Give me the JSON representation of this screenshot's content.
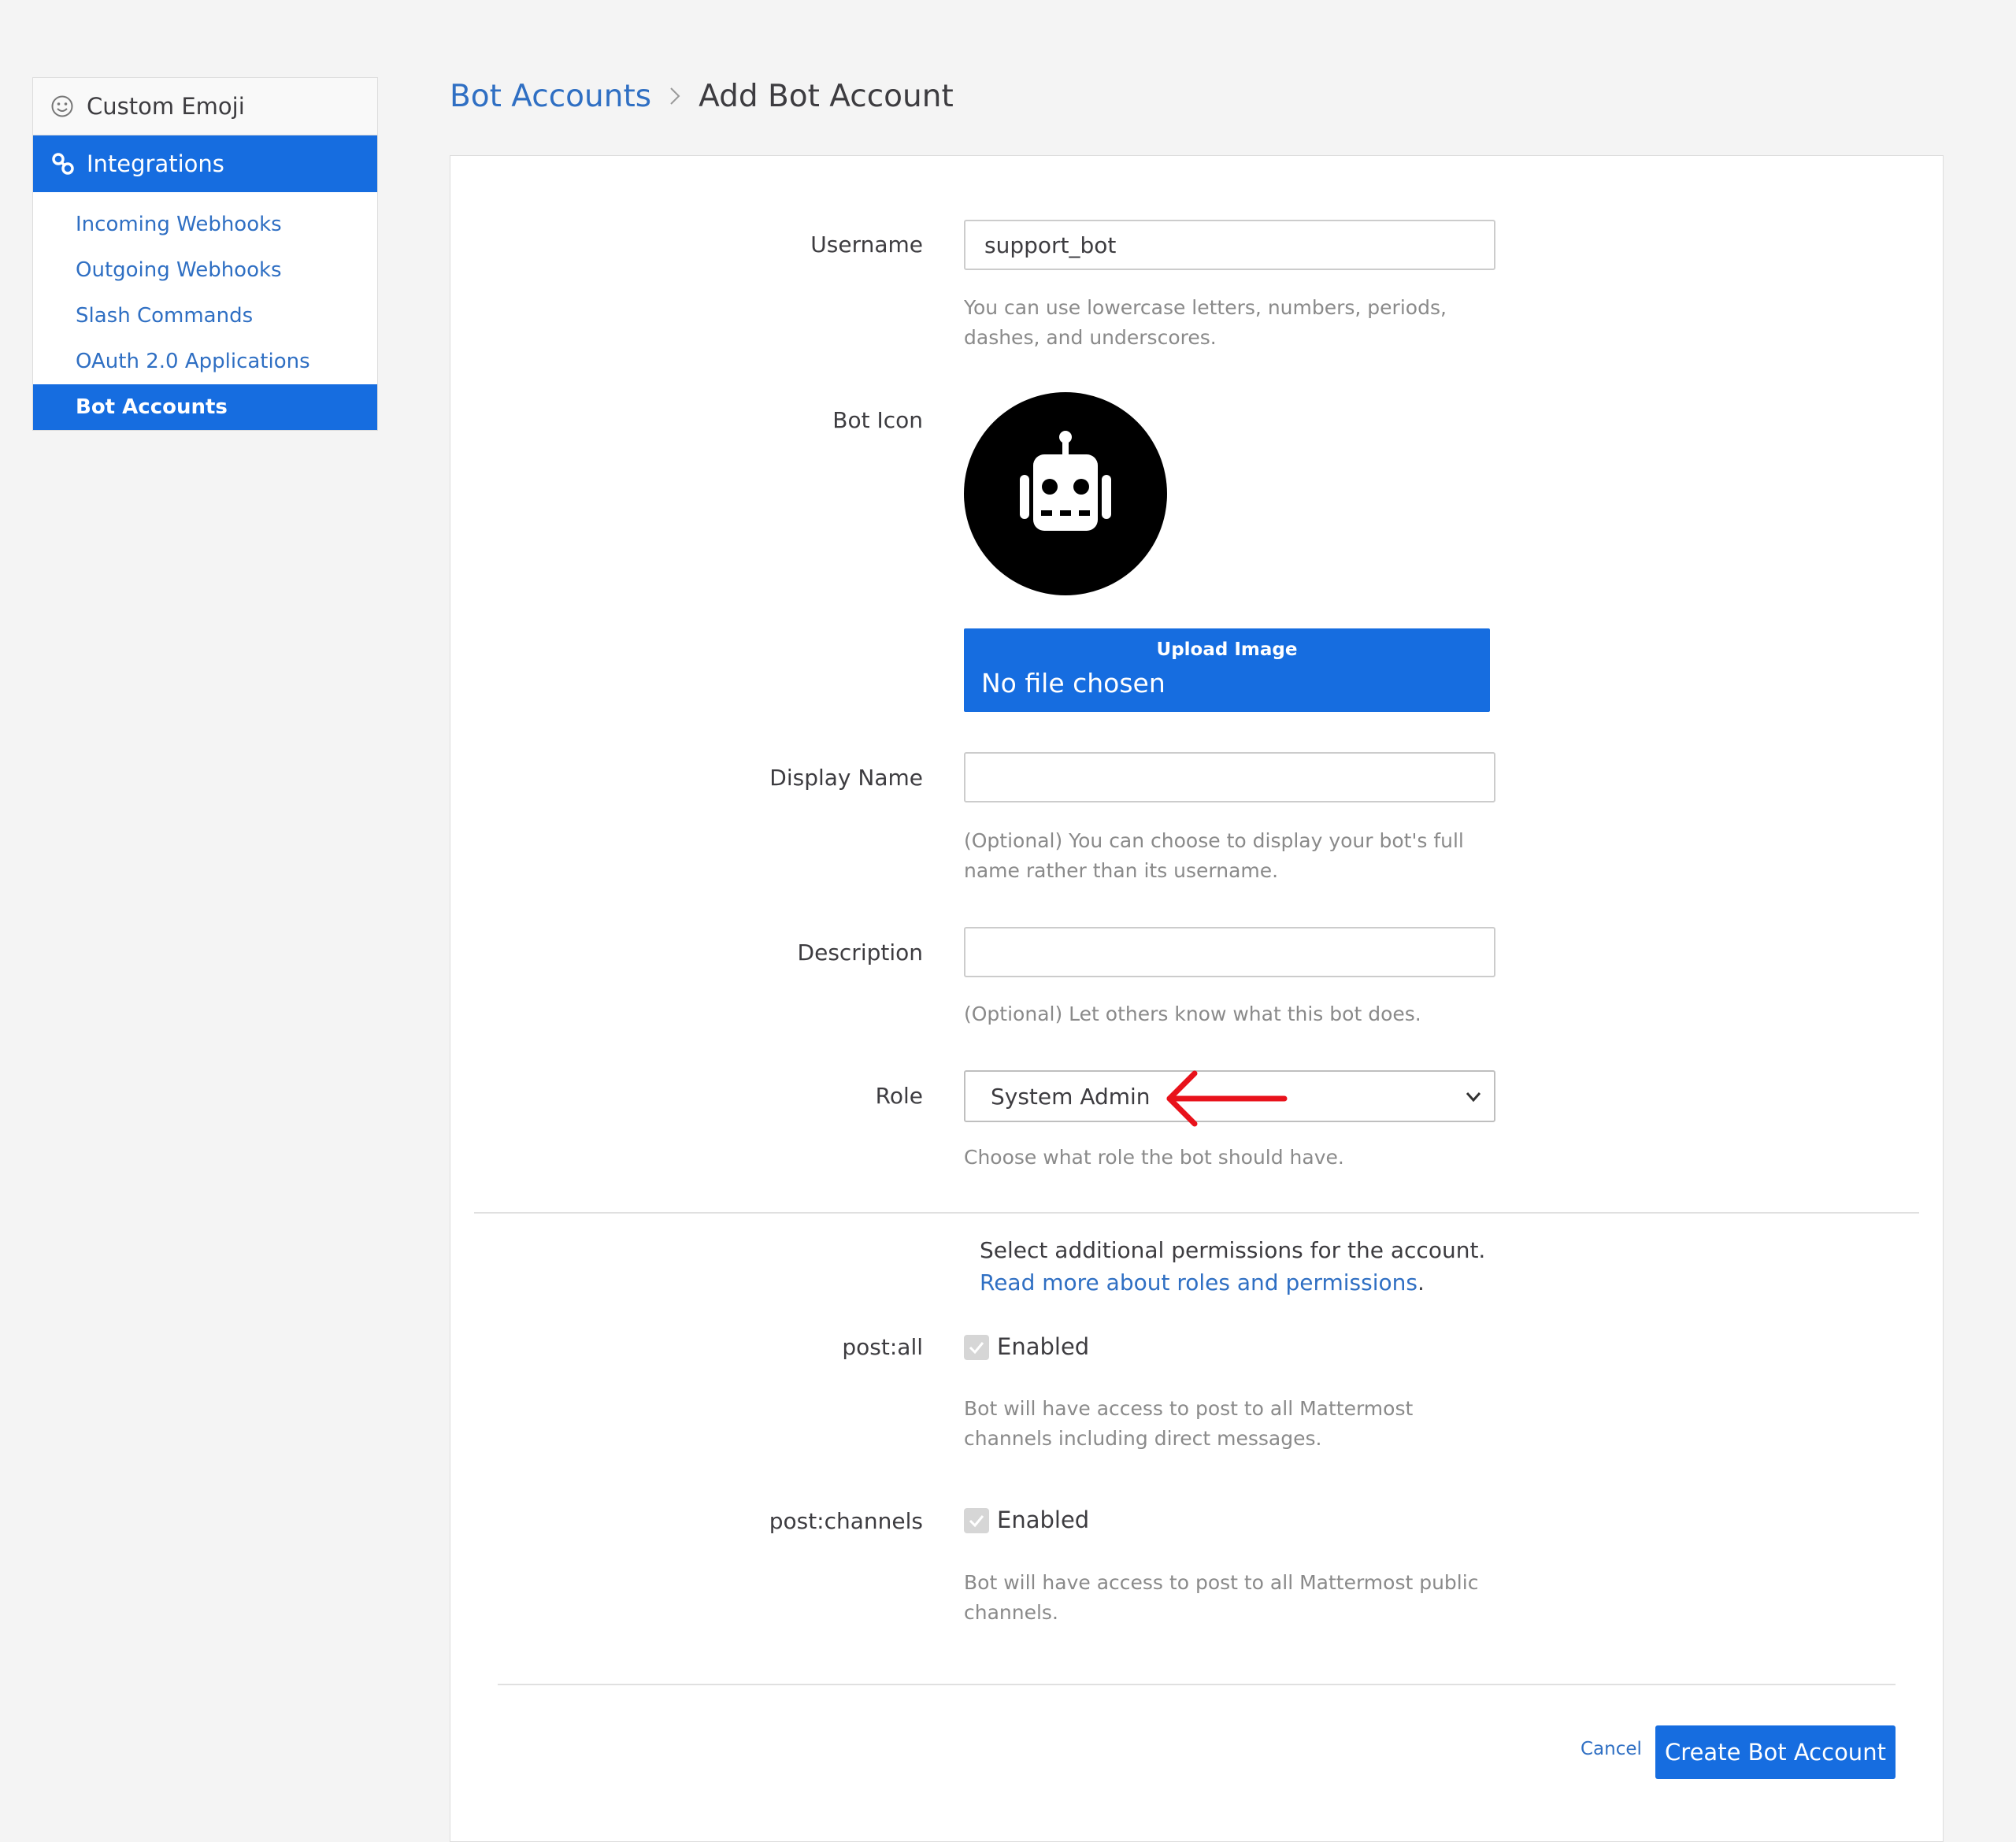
{
  "sidebar": {
    "header_label": "Custom Emoji",
    "section_label": "Integrations",
    "items": [
      {
        "label": "Incoming Webhooks"
      },
      {
        "label": "Outgoing Webhooks"
      },
      {
        "label": "Slash Commands"
      },
      {
        "label": "OAuth 2.0 Applications"
      },
      {
        "label": "Bot Accounts",
        "active": true
      }
    ]
  },
  "breadcrumb": {
    "parent": "Bot Accounts",
    "current": "Add Bot Account"
  },
  "form": {
    "username": {
      "label": "Username",
      "value": "support_bot",
      "help": "You can use lowercase letters, numbers, periods, dashes, and underscores."
    },
    "bot_icon": {
      "label": "Bot Icon",
      "upload_title": "Upload Image",
      "upload_status": "No file chosen"
    },
    "display_name": {
      "label": "Display Name",
      "value": "",
      "help": "(Optional) You can choose to display your bot's full name rather than its username."
    },
    "description": {
      "label": "Description",
      "value": "",
      "help": "(Optional) Let others know what this bot does."
    },
    "role": {
      "label": "Role",
      "selected": "System Admin",
      "help": "Choose what role the bot should have."
    },
    "permissions": {
      "intro_text": "Select additional permissions for the account. ",
      "intro_link": "Read more about roles and permissions",
      "intro_end": ".",
      "items": [
        {
          "label": "post:all",
          "checkbox_label": "Enabled",
          "checked": true,
          "help": "Bot will have access to post to all Mattermost channels including direct messages."
        },
        {
          "label": "post:channels",
          "checkbox_label": "Enabled",
          "checked": true,
          "help": "Bot will have access to post to all Mattermost public channels."
        }
      ]
    }
  },
  "actions": {
    "cancel": "Cancel",
    "create": "Create Bot Account"
  },
  "colors": {
    "accent": "#166de0",
    "link": "#2f6fc3",
    "annotation_arrow": "#e8121b"
  },
  "icons": [
    "emoji-icon",
    "integrations-icon",
    "chevron-right-icon",
    "robot-icon",
    "chevron-down-icon",
    "checkmark-icon",
    "red-arrow-annotation"
  ]
}
